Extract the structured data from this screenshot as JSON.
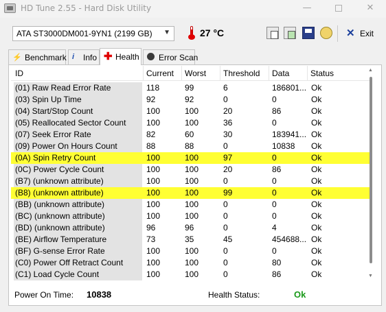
{
  "window": {
    "title": "HD Tune 2.55 - Hard Disk Utility",
    "minimize_glyph": "—",
    "close_glyph": "✕"
  },
  "toolbar": {
    "drive": "ATA     ST3000DM001-9YN1 (2199 GB)",
    "temperature": "27 °C",
    "exit_label": "Exit",
    "icons": [
      "copy-text-icon",
      "copy-screenshot-icon",
      "save-icon",
      "options-icon",
      "exit-icon"
    ]
  },
  "tabs": [
    {
      "label": "Benchmark",
      "icon": "benchmark-icon"
    },
    {
      "label": "Info",
      "icon": "info-icon"
    },
    {
      "label": "Health",
      "icon": "health-cross-icon",
      "selected": true
    },
    {
      "label": "Error Scan",
      "icon": "error-scan-icon"
    }
  ],
  "table": {
    "columns": [
      "ID",
      "Current",
      "Worst",
      "Threshold",
      "Data",
      "Status"
    ],
    "rows": [
      {
        "id": "(01) Raw Read Error Rate",
        "current": "118",
        "worst": "99",
        "threshold": "6",
        "data": "186801...",
        "status": "Ok",
        "highlight": false
      },
      {
        "id": "(03) Spin Up Time",
        "current": "92",
        "worst": "92",
        "threshold": "0",
        "data": "0",
        "status": "Ok",
        "highlight": false
      },
      {
        "id": "(04) Start/Stop Count",
        "current": "100",
        "worst": "100",
        "threshold": "20",
        "data": "86",
        "status": "Ok",
        "highlight": false
      },
      {
        "id": "(05) Reallocated Sector Count",
        "current": "100",
        "worst": "100",
        "threshold": "36",
        "data": "0",
        "status": "Ok",
        "highlight": false
      },
      {
        "id": "(07) Seek Error Rate",
        "current": "82",
        "worst": "60",
        "threshold": "30",
        "data": "183941...",
        "status": "Ok",
        "highlight": false
      },
      {
        "id": "(09) Power On Hours Count",
        "current": "88",
        "worst": "88",
        "threshold": "0",
        "data": "10838",
        "status": "Ok",
        "highlight": false
      },
      {
        "id": "(0A) Spin Retry Count",
        "current": "100",
        "worst": "100",
        "threshold": "97",
        "data": "0",
        "status": "Ok",
        "highlight": true
      },
      {
        "id": "(0C) Power Cycle Count",
        "current": "100",
        "worst": "100",
        "threshold": "20",
        "data": "86",
        "status": "Ok",
        "highlight": false
      },
      {
        "id": "(B7) (unknown attribute)",
        "current": "100",
        "worst": "100",
        "threshold": "0",
        "data": "0",
        "status": "Ok",
        "highlight": false
      },
      {
        "id": "(B8) (unknown attribute)",
        "current": "100",
        "worst": "100",
        "threshold": "99",
        "data": "0",
        "status": "Ok",
        "highlight": true
      },
      {
        "id": "(BB) (unknown attribute)",
        "current": "100",
        "worst": "100",
        "threshold": "0",
        "data": "0",
        "status": "Ok",
        "highlight": false
      },
      {
        "id": "(BC) (unknown attribute)",
        "current": "100",
        "worst": "100",
        "threshold": "0",
        "data": "0",
        "status": "Ok",
        "highlight": false
      },
      {
        "id": "(BD) (unknown attribute)",
        "current": "96",
        "worst": "96",
        "threshold": "0",
        "data": "4",
        "status": "Ok",
        "highlight": false
      },
      {
        "id": "(BE) Airflow Temperature",
        "current": "73",
        "worst": "35",
        "threshold": "45",
        "data": "454688...",
        "status": "Ok",
        "highlight": false
      },
      {
        "id": "(BF) G-sense Error Rate",
        "current": "100",
        "worst": "100",
        "threshold": "0",
        "data": "0",
        "status": "Ok",
        "highlight": false
      },
      {
        "id": "(C0) Power Off Retract Count",
        "current": "100",
        "worst": "100",
        "threshold": "0",
        "data": "80",
        "status": "Ok",
        "highlight": false
      },
      {
        "id": "(C1) Load Cycle Count",
        "current": "100",
        "worst": "100",
        "threshold": "0",
        "data": "86",
        "status": "Ok",
        "highlight": false
      }
    ]
  },
  "footer": {
    "power_on_label": "Power On Time:",
    "power_on_value": "10838",
    "health_label": "Health Status:",
    "health_value": "Ok",
    "health_color": "#1a9a1a"
  },
  "colors": {
    "highlight": "#ffff33",
    "id_cell": "#e3e3e3"
  }
}
